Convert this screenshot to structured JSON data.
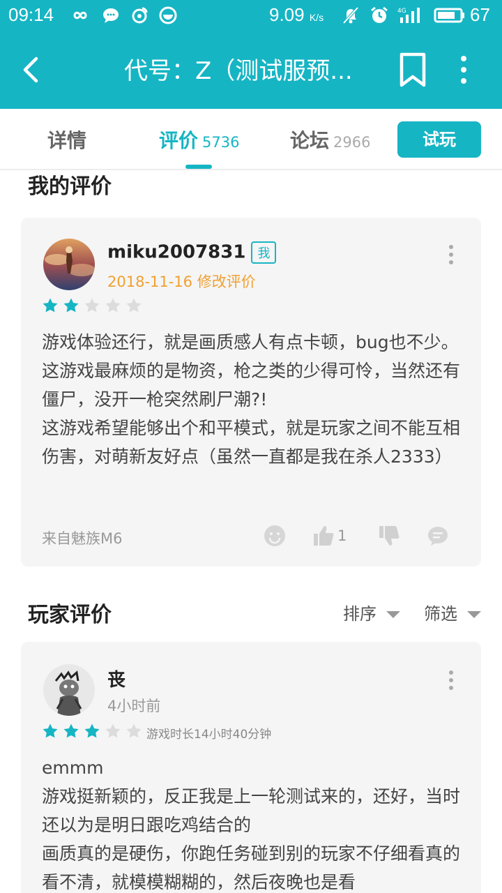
{
  "status": {
    "time": "09:14",
    "speed": "9.09",
    "speed_unit": "K/s",
    "battery": "67"
  },
  "appbar": {
    "title": "代号：Z（测试服预..."
  },
  "tabs": [
    {
      "label": "详情",
      "count": ""
    },
    {
      "label": "评价",
      "count": "5736"
    },
    {
      "label": "论坛",
      "count": "2966"
    }
  ],
  "play_button": "试玩",
  "my_review": {
    "section_title": "我的评价",
    "username": "miku2007831",
    "badge": "我",
    "meta": "2018-11-16 修改评价",
    "rating": 2,
    "paragraphs": [
      "游戏体验还行，就是画质感人有点卡顿，bug也不少。这游戏最麻烦的是物资，枪之类的少得可怜，当然还有僵尸，没开一枪突然刷尸潮?!",
      "这游戏希望能够出个和平模式，就是玩家之间不能互相伤害，对萌新友好点（虽然一直都是我在杀人2333）"
    ],
    "device": "来自魅族M6",
    "likes": "1"
  },
  "player_reviews": {
    "section_title": "玩家评价",
    "sort_label": "排序",
    "filter_label": "筛选",
    "first": {
      "username": "丧",
      "meta": "4小时前",
      "rating": 3,
      "playtime": "游戏时长14小时40分钟",
      "paragraphs": [
        "emmm",
        "游戏挺新颖的，反正我是上一轮测试来的，还好，当时还以为是明日跟吃鸡结合的",
        "画质真的是硬伤，你跑任务碰到别的玩家不仔细看真的看不清，就模模糊糊的，然后夜晚也是看"
      ]
    }
  },
  "colors": {
    "accent": "#16b5c4",
    "meta_orange": "#f0a030",
    "card_bg": "#f5f5f5"
  }
}
